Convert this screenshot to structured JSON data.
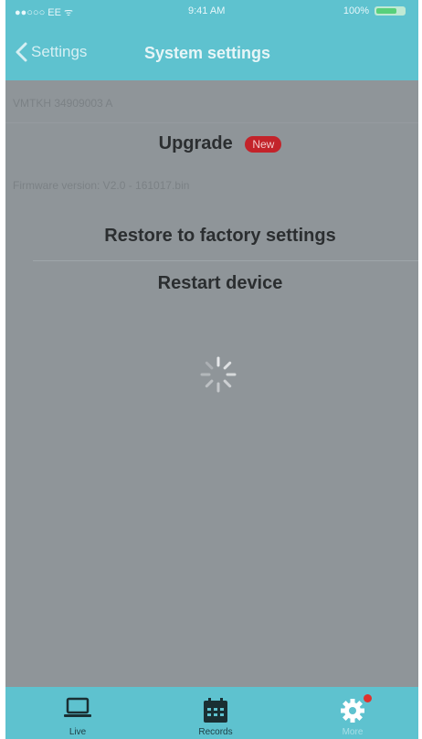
{
  "status_bar": {
    "carrier": "●●○○○ EE  ᯤ",
    "time": "9:41 AM",
    "battery_label": "100%"
  },
  "nav": {
    "back_label": "Settings",
    "title": "System settings"
  },
  "background_rows": {
    "row1": "VMTKH 34909003 A",
    "row2": "Firmware version: V2.0 - 161017.bin"
  },
  "menu": {
    "upgrade_label": "Upgrade",
    "badge": "New",
    "restore_label": "Restore to factory settings",
    "restart_label": "Restart device"
  },
  "tabs": [
    {
      "label": "Live",
      "icon": "laptop-icon"
    },
    {
      "label": "Records",
      "icon": "calendar-icon"
    },
    {
      "label": "More",
      "icon": "gear-icon"
    }
  ],
  "colors": {
    "accent": "#5ec2cf",
    "overlay": "#8f9599",
    "badge": "#c3232a",
    "notification_dot": "#e0322d"
  }
}
